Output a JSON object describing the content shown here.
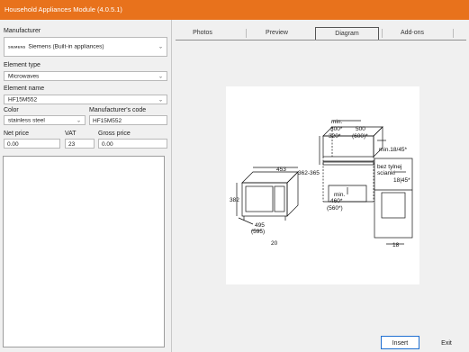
{
  "window": {
    "title": "Household Appliances Module  (4.0.5.1)"
  },
  "form": {
    "manufacturer_label": "Manufacturer",
    "manufacturer_brand": "SIEMENS",
    "manufacturer_value": "Siemens (Built-in appliances)",
    "element_type_label": "Element type",
    "element_type_value": "Microwaves",
    "element_name_label": "Element name",
    "element_name_value": "HF15M552",
    "color_label": "Color",
    "color_value": "stainless steel",
    "manufacturer_code_label": "Manufacturer's code",
    "manufacturer_code_value": "HF15M552",
    "net_price_label": "Net price",
    "net_price_value": "0.00",
    "vat_label": "VAT",
    "vat_value": "23",
    "gross_price_label": "Gross price",
    "gross_price_value": "0.00"
  },
  "tabs": [
    {
      "label": "Photos"
    },
    {
      "label": "Preview"
    },
    {
      "label": "Diagram",
      "active": true
    },
    {
      "label": "Add-ons"
    }
  ],
  "diagram": {
    "dim_453": "453",
    "dim_382": "382",
    "dim_495": "495",
    "dim_595": "(595)",
    "dim_20": "20",
    "dim_362_365": "362-365",
    "dim_min300": "min.",
    "dim_300": "300*",
    "dim_320": "320*",
    "dim_500": "500",
    "dim_600": "(600)*",
    "dim_min18_45": "min.18/45*",
    "dim_min460_label": "min.",
    "dim_460": "460*",
    "dim_560": "(560*)",
    "dim_bez_tylnej": "bez tylnej",
    "dim_scianki": "scianki",
    "dim_18_45": "18|45*",
    "dim_18": "18"
  },
  "buttons": {
    "insert": "Insert",
    "exit": "Exit"
  },
  "colors": {
    "titlebar": "#e8721c",
    "accent_border": "#1f6fd1"
  }
}
